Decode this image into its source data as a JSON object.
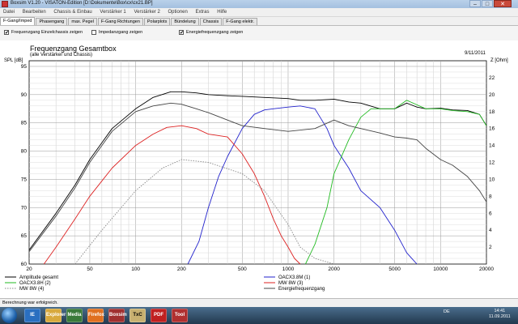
{
  "window": {
    "title": "Boxsim V1.20 - VISATON-Edition  [D:\\Dokumente\\Box\\cx\\cx21.BP]",
    "buttons": [
      "–",
      "□",
      "✕"
    ]
  },
  "menu": [
    "Datei",
    "Bearbeiten",
    "Chassis & Einbau",
    "Verstärker 1",
    "Verstärker 2",
    "Optionen",
    "Extras",
    "Hilfe"
  ],
  "tabs": [
    {
      "label": "F-Gang/Imped",
      "active": true
    },
    {
      "label": "Phasengang",
      "active": false
    },
    {
      "label": "max. Pegel",
      "active": false
    },
    {
      "label": "F-Gang Richtungen",
      "active": false
    },
    {
      "label": "Polarplots",
      "active": false
    },
    {
      "label": "Bündelung",
      "active": false
    },
    {
      "label": "Chassis",
      "active": false
    },
    {
      "label": "F-Gang elektr.",
      "active": false
    }
  ],
  "options": [
    {
      "label": "Frequenzgang Einzelchassis zeigen",
      "checked": true
    },
    {
      "label": "Impedanzgang zeigen",
      "checked": false
    },
    {
      "label": "Energiefrequenzgang zeigen",
      "checked": true
    }
  ],
  "plot": {
    "title": "Frequenzgang Gesamtbox",
    "subtitle": "(alle Verstärker und Chassis)",
    "date": "9/11/2011",
    "ylabel_left": "SPL [dB]",
    "ylabel_right": "Z [Ohm]"
  },
  "status": "Berechnung war erfolgreich.",
  "taskbar": {
    "items": [
      "IE",
      "Explorer",
      "Media",
      "Firefox",
      "Boxsim",
      "TxC",
      "PDF",
      "Tool"
    ],
    "lang": "DE",
    "time": "14:41",
    "date": "11.09.2011"
  },
  "colors": {
    "amplitude": "#000000",
    "oacx3_8m": "#2222cc",
    "oacx3_8h": "#22bb22",
    "mw8w3": "#dd2222",
    "mw8w4": "#888888",
    "energy": "#444444"
  },
  "chart_data": {
    "type": "line",
    "xlabel": "",
    "ylabel": "SPL [dB]",
    "y2label": "Z [Ohm]",
    "xscale": "log",
    "xlim": [
      20,
      20000
    ],
    "ylim": [
      60,
      96
    ],
    "y2lim": [
      0,
      24
    ],
    "x_ticks": [
      20,
      50,
      100,
      200,
      500,
      1000,
      2000,
      5000,
      10000,
      20000
    ],
    "y_ticks": [
      60,
      65,
      70,
      75,
      80,
      85,
      90,
      95
    ],
    "y2_ticks": [
      2,
      4,
      6,
      8,
      10,
      12,
      14,
      16,
      18,
      20,
      22
    ],
    "grid": true,
    "legend_position": "bottom",
    "series": [
      {
        "name": "Amplitude gesamt",
        "color": "#000000",
        "dash": "solid",
        "x": [
          20,
          30,
          40,
          50,
          70,
          100,
          130,
          170,
          200,
          250,
          300,
          400,
          500,
          700,
          1000,
          1200,
          1500,
          2000,
          2500,
          3000,
          4000,
          5000,
          6000,
          7000,
          8000,
          10000,
          12000,
          15000,
          18000,
          20000
        ],
        "y": [
          62.5,
          69,
          74,
          78.5,
          84,
          87.5,
          89.5,
          90.5,
          90.5,
          90.3,
          90,
          89.8,
          89.7,
          89.5,
          89.3,
          89,
          89,
          89.2,
          88.7,
          88.5,
          87.5,
          87.5,
          88.5,
          87.8,
          87.5,
          87.6,
          87.3,
          87.2,
          86.5,
          84.5
        ]
      },
      {
        "name": "OACX3.8M (1)",
        "color": "#2222cc",
        "dash": "solid",
        "x": [
          220,
          260,
          300,
          350,
          400,
          500,
          600,
          700,
          800,
          1000,
          1200,
          1500,
          1800,
          2000,
          2500,
          3000,
          4000,
          5000,
          6000,
          7000
        ],
        "y": [
          60,
          64,
          70,
          75.5,
          79,
          84,
          86.5,
          87.3,
          87.5,
          87.8,
          88,
          87.5,
          84,
          81,
          77,
          73,
          70,
          66,
          62,
          60
        ]
      },
      {
        "name": "OACX3.8H (2)",
        "color": "#22bb22",
        "dash": "solid",
        "x": [
          1300,
          1500,
          1800,
          2000,
          2500,
          3000,
          3500,
          4000,
          5000,
          6000,
          7000,
          8000,
          10000,
          12000,
          15000,
          18000,
          20000
        ],
        "y": [
          60,
          63.5,
          70,
          76,
          82,
          86,
          87.5,
          87.5,
          87.5,
          89,
          88.2,
          87.5,
          87.5,
          87.2,
          87,
          86.5,
          84.5
        ]
      },
      {
        "name": "MW 8W (3)",
        "color": "#dd2222",
        "dash": "solid",
        "x": [
          25,
          30,
          40,
          50,
          70,
          100,
          130,
          160,
          200,
          250,
          300,
          400,
          500,
          600,
          700,
          800,
          900,
          1000,
          1100,
          1200
        ],
        "y": [
          60,
          63,
          68,
          72,
          77,
          81,
          83,
          84.2,
          84.5,
          84,
          83,
          82.5,
          79.5,
          76,
          72,
          68,
          65,
          63,
          61,
          60
        ]
      },
      {
        "name": "MW 8W (4)",
        "color": "#888888",
        "dash": "dotted",
        "x": [
          40,
          60,
          100,
          150,
          200,
          300,
          500,
          700,
          1000,
          1200,
          1500,
          2000
        ],
        "y": [
          60,
          66,
          73,
          77,
          78.5,
          78,
          76,
          73,
          67,
          63,
          61,
          60
        ]
      },
      {
        "name": "Energiefrequenzgang",
        "color": "#444444",
        "dash": "solid",
        "x": [
          20,
          30,
          40,
          50,
          70,
          100,
          130,
          170,
          200,
          250,
          300,
          400,
          500,
          700,
          1000,
          1500,
          2000,
          2500,
          3000,
          4000,
          5000,
          6000,
          7000,
          8000,
          10000,
          12000,
          15000,
          18000,
          20000
        ],
        "y": [
          62.2,
          68.5,
          73.5,
          78,
          83.5,
          87,
          88,
          88.5,
          88.3,
          87.5,
          86.8,
          85.5,
          84.5,
          84,
          83.5,
          84,
          85.5,
          84.5,
          84,
          83.2,
          82.5,
          82.3,
          82,
          80.5,
          78.5,
          77.5,
          75.5,
          73,
          71
        ]
      }
    ]
  }
}
